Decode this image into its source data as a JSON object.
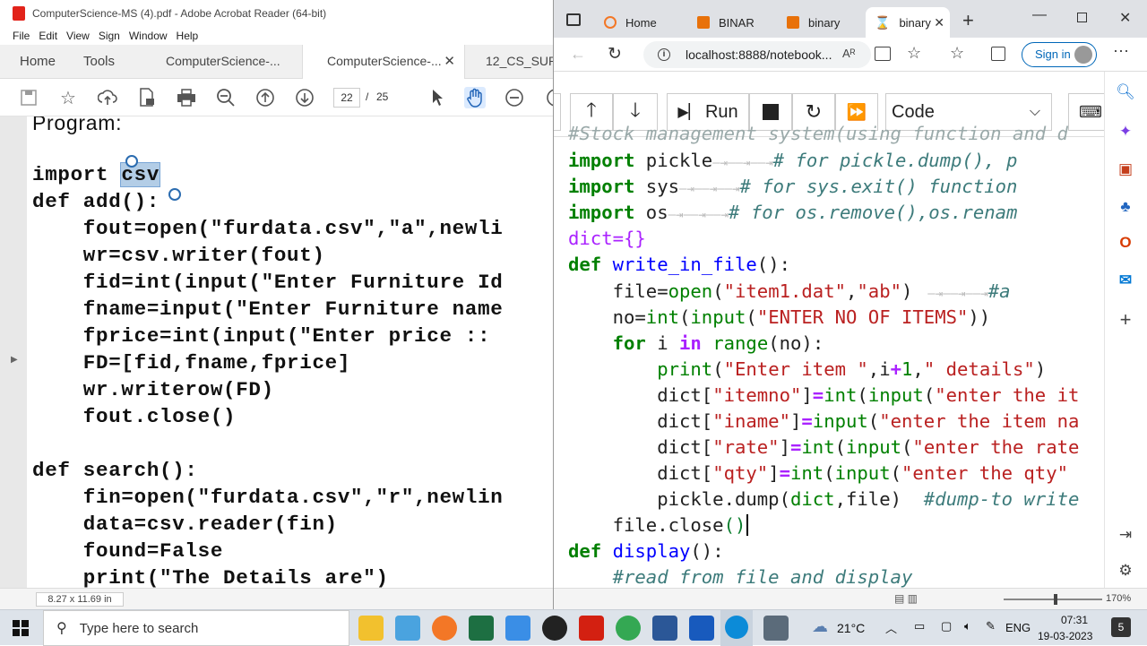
{
  "acrobat": {
    "title": "ComputerScience-MS (4).pdf - Adobe Acrobat Reader (64-bit)",
    "menu": [
      "File",
      "Edit",
      "View",
      "Sign",
      "Window",
      "Help"
    ],
    "tabs": {
      "home": "Home",
      "tools": "Tools",
      "doc1": "ComputerScience-...",
      "doc2": "ComputerScience-...",
      "doc3": "12_CS_SUPP"
    },
    "page_current": "22",
    "page_sep": "/",
    "page_total": "25",
    "page_size": "8.27 x 11.69 in",
    "code_lines": [
      "Program:",
      "",
      "import csv",
      "def add():",
      "    fout=open(\"furdata.csv\",\"a\",newli",
      "    wr=csv.writer(fout)",
      "    fid=int(input(\"Enter Furniture Id",
      "    fname=input(\"Enter Furniture name",
      "    fprice=int(input(\"Enter price ::",
      "    FD=[fid,fname,fprice]",
      "    wr.writerow(FD)",
      "    fout.close()",
      "",
      "def search():",
      "    fin=open(\"furdata.csv\",\"r\",newlin",
      "    data=csv.reader(fin)",
      "    found=False",
      "    print(\"The Details are\")"
    ],
    "selected_word": "csv"
  },
  "edge": {
    "tabs": [
      {
        "label": "Home",
        "color": "#f37726"
      },
      {
        "label": "BINAR",
        "color": "#e8710a"
      },
      {
        "label": "binary",
        "color": "#e8710a"
      },
      {
        "label": "binary",
        "color": "#f37726"
      }
    ],
    "url": "localhost:8888/notebook...",
    "signin": "Sign in",
    "run_label": "Run",
    "cell_type": "Code",
    "zoom": "170%",
    "lines": {
      "l0": "#Stock management system(using function and d",
      "l1a": "import",
      "l1b": " pickle",
      "l1c": "# for pickle.dump(), p",
      "l2a": "import",
      "l2b": " sys",
      "l2c": "# for sys.exit() function",
      "l3a": "import",
      "l3b": " os",
      "l3c": "# for os.remove(),os.renam",
      "l4": "dict={}",
      "l5a": "def",
      "l5b": " write_in_file",
      "l5c": "():",
      "l6a": "    file=",
      "l6b": "open",
      "l6c": "(",
      "l6d": "\"item1.dat\"",
      "l6e": ",",
      "l6f": "\"ab\"",
      "l6g": ")",
      "l6h": "#a",
      "l7a": "    no=",
      "l7b": "int",
      "l7c": "(",
      "l7d": "input",
      "l7e": "(",
      "l7f": "\"ENTER NO OF ITEMS\"",
      "l7g": "))",
      "l8a": "    ",
      "l8b": "for",
      "l8c": " i ",
      "l8d": "in",
      "l8e": " ",
      "l8f": "range",
      "l8g": "(no):",
      "l9a": "        ",
      "l9b": "print",
      "l9c": "(",
      "l9d": "\"Enter item \"",
      "l9e": ",i",
      "l9f": "+",
      "l9g": "1",
      "l9h": ",",
      "l9i": "\" details\"",
      "l9j": ")",
      "l10a": "        dict[",
      "l10b": "\"itemno\"",
      "l10c": "]",
      "l10d": "=",
      "l10e": "int",
      "l10f": "(",
      "l10g": "input",
      "l10h": "(",
      "l10i": "\"enter the it",
      "l11a": "        dict[",
      "l11b": "\"iname\"",
      "l11c": "]",
      "l11d": "=",
      "l11e": "input",
      "l11f": "(",
      "l11g": "\"enter the item na",
      "l12a": "        dict[",
      "l12b": "\"rate\"",
      "l12c": "]",
      "l12d": "=",
      "l12e": "int",
      "l12f": "(",
      "l12g": "input",
      "l12h": "(",
      "l12i": "\"enter the rate",
      "l13a": "        dict[",
      "l13b": "\"qty\"",
      "l13c": "]",
      "l13d": "=",
      "l13e": "int",
      "l13f": "(",
      "l13g": "input",
      "l13h": "(",
      "l13i": "\"enter the qty\"",
      "l14a": "        pickle.dump(",
      "l14b": "dict",
      "l14c": ",file)  ",
      "l14d": "#dump-to write",
      "l15a": "    file.close",
      "l15b": "()",
      "l16a": "def",
      "l16b": " display",
      "l16c": "():",
      "l17": "    #read from file and display"
    }
  },
  "taskbar": {
    "search_placeholder": "Type here to search",
    "weather": "21°C",
    "lang": "ENG",
    "time": "07:31",
    "date": "19-03-2023",
    "notif": "5"
  }
}
